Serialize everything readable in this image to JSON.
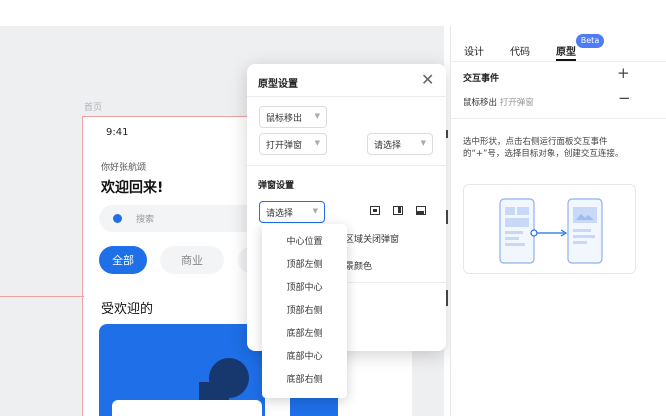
{
  "canvas": {
    "artboard_label": "首页",
    "phone": {
      "time": "9:41",
      "greeting": "你好张航颂",
      "welcome": "欢迎回来!",
      "search_placeholder": "搜索",
      "chips": [
        "全部",
        "商业"
      ],
      "section_title": "受欢迎的"
    }
  },
  "popover": {
    "title": "原型设置",
    "trigger_select": "鼠标移出",
    "action_select": "打开弹窗",
    "target_select": "请选择",
    "section_title": "弹窗设置",
    "position_select": "请选择",
    "option_close_outside": "区域关闭弹窗",
    "option_color": "景颜色"
  },
  "dropdown": {
    "options": [
      "中心位置",
      "顶部左侧",
      "顶部中心",
      "顶部右侧",
      "底部左侧",
      "底部中心",
      "底部右侧"
    ]
  },
  "panel": {
    "tabs": [
      "设计",
      "代码",
      "原型"
    ],
    "active_tab": "原型",
    "beta_badge": "Beta",
    "interaction_heading": "交互事件",
    "event_trigger": "鼠标移出",
    "event_action": "打开弹窗",
    "description": "选中形状，点击右侧运行面板交互事件的“+”号，选择目标对象，创建交互连接。"
  },
  "colors": {
    "accent": "#1e6fe8",
    "beta": "#4f7cf5",
    "guide": "#f0a2a2"
  }
}
